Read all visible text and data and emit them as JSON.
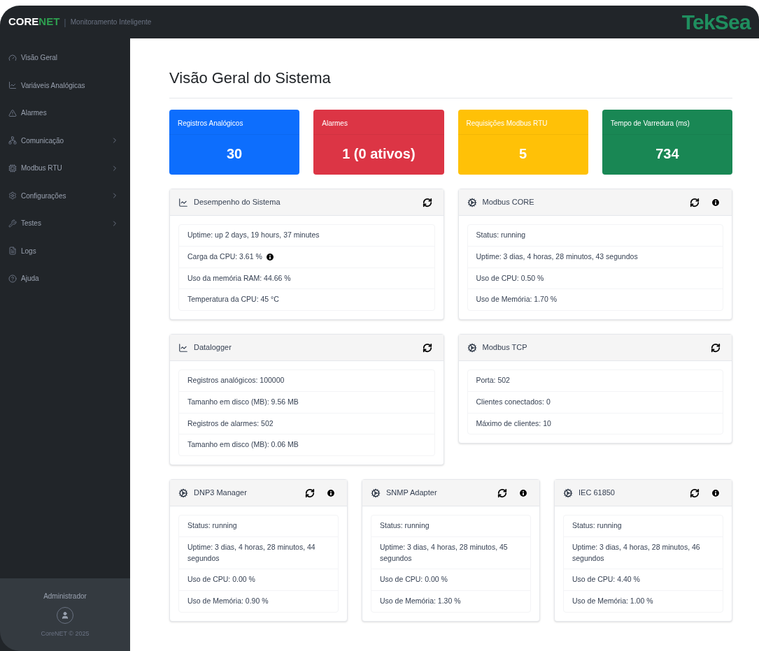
{
  "header": {
    "brand_a": "CORE",
    "brand_b": "NET",
    "separator": "|",
    "subtitle": "Monitoramento Inteligente",
    "logo": "TekSea"
  },
  "sidebar": {
    "items": [
      {
        "label": "Visão Geral",
        "expandable": false
      },
      {
        "label": "Variáveis Analógicas",
        "expandable": false
      },
      {
        "label": "Alarmes",
        "expandable": false
      },
      {
        "label": "Comunicação",
        "expandable": true
      },
      {
        "label": "Modbus RTU",
        "expandable": true
      },
      {
        "label": "Configurações",
        "expandable": true
      },
      {
        "label": "Testes",
        "expandable": true
      },
      {
        "label": "Logs",
        "expandable": false
      },
      {
        "label": "Ajuda",
        "expandable": false
      }
    ],
    "user": "Administrador",
    "footer": "CoreNET © 2025"
  },
  "page_title": "Visão Geral do Sistema",
  "stats": [
    {
      "label": "Registros Analógicos",
      "value": "30",
      "color": "#0d6efd"
    },
    {
      "label": "Alarmes",
      "value": "1 (0 ativos)",
      "color": "#dc3545"
    },
    {
      "label": "Requisições Modbus RTU",
      "value": "5",
      "color": "#ffc107"
    },
    {
      "label": "Tempo de Varredura (ms)",
      "value": "734",
      "color": "#198754"
    }
  ],
  "panels": [
    {
      "title": "Desempenho do Sistema",
      "kind": "chart",
      "info_button": false,
      "rows": [
        {
          "text": "Uptime: up 2 days, 19 hours, 37 minutes",
          "info": false
        },
        {
          "text": "Carga da CPU: 3.61 %",
          "info": true
        },
        {
          "text": "Uso da memória RAM: 44.66 %",
          "info": false
        },
        {
          "text": "Temperatura da CPU: 45 °C",
          "info": false
        }
      ]
    },
    {
      "title": "Modbus CORE",
      "kind": "service",
      "info_button": true,
      "rows": [
        {
          "text": "Status: running",
          "info": false
        },
        {
          "text": "Uptime: 3 dias, 4 horas, 28 minutos, 43 segundos",
          "info": false
        },
        {
          "text": "Uso de CPU: 0.50 %",
          "info": false
        },
        {
          "text": "Uso de Memória: 1.70 %",
          "info": false
        }
      ]
    },
    {
      "title": "Datalogger",
      "kind": "chart",
      "info_button": false,
      "rows": [
        {
          "text": "Registros analógicos: 100000",
          "info": false
        },
        {
          "text": "Tamanho em disco (MB): 9.56 MB",
          "info": false
        },
        {
          "text": "Registros de alarmes: 502",
          "info": false
        },
        {
          "text": "Tamanho em disco (MB): 0.06 MB",
          "info": false
        }
      ]
    },
    {
      "title": "Modbus TCP",
      "kind": "service",
      "info_button": false,
      "rows": [
        {
          "text": "Porta: 502",
          "info": false
        },
        {
          "text": "Clientes conectados: 0",
          "info": false
        },
        {
          "text": "Máximo de clientes: 10",
          "info": false
        }
      ]
    },
    {
      "title": "DNP3 Manager",
      "kind": "service",
      "info_button": true,
      "rows": [
        {
          "text": "Status: running",
          "info": false
        },
        {
          "text": "Uptime: 3 dias, 4 horas, 28 minutos, 44 segundos",
          "info": false
        },
        {
          "text": "Uso de CPU: 0.00 %",
          "info": false
        },
        {
          "text": "Uso de Memória: 0.90 %",
          "info": false
        }
      ]
    },
    {
      "title": "SNMP Adapter",
      "kind": "service",
      "info_button": true,
      "rows": [
        {
          "text": "Status: running",
          "info": false
        },
        {
          "text": "Uptime: 3 dias, 4 horas, 28 minutos, 45 segundos",
          "info": false
        },
        {
          "text": "Uso de CPU: 0.00 %",
          "info": false
        },
        {
          "text": "Uso de Memória: 1.30 %",
          "info": false
        }
      ]
    },
    {
      "title": "IEC 61850",
      "kind": "service",
      "info_button": true,
      "rows": [
        {
          "text": "Status: running",
          "info": false
        },
        {
          "text": "Uptime: 3 dias, 4 horas, 28 minutos, 46 segundos",
          "info": false
        },
        {
          "text": "Uso de CPU: 4.40 %",
          "info": false
        },
        {
          "text": "Uso de Memória: 1.00 %",
          "info": false
        }
      ]
    }
  ]
}
